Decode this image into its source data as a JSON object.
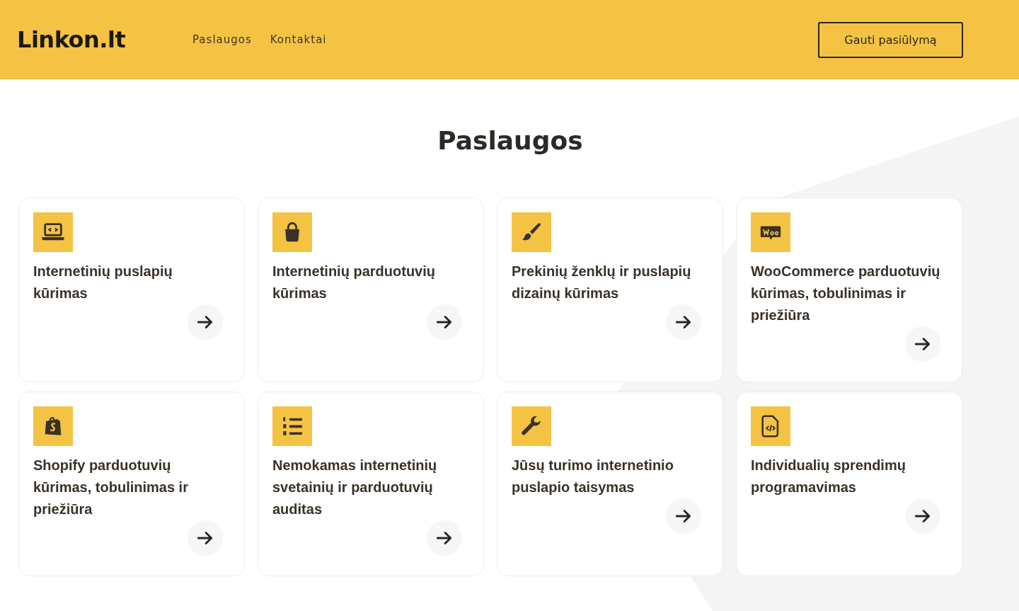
{
  "header": {
    "logo": "Linkon.lt",
    "nav": [
      {
        "label": "Paslaugos"
      },
      {
        "label": "Kontaktai"
      }
    ],
    "cta": "Gauti pasiūlymą"
  },
  "heading": "Paslaugos",
  "services": [
    {
      "title": "Internetinių puslapių kūrimas"
    },
    {
      "title": "Internetinių parduotuvių kūrimas"
    },
    {
      "title": "Prekinių ženklų ir puslapių dizainų kūrimas"
    },
    {
      "title": "WooCommerce parduotuvių kūrimas, tobulinimas ir priežiūra"
    },
    {
      "title": "Shopify parduotuvių kūrimas, tobulinimas ir priežiūra"
    },
    {
      "title": "Nemokamas internetinių svetainių ir parduotuvių auditas"
    },
    {
      "title": "Jūsų turimo internetinio puslapio taisymas"
    },
    {
      "title": "Individualių sprendimų programavimas"
    }
  ]
}
